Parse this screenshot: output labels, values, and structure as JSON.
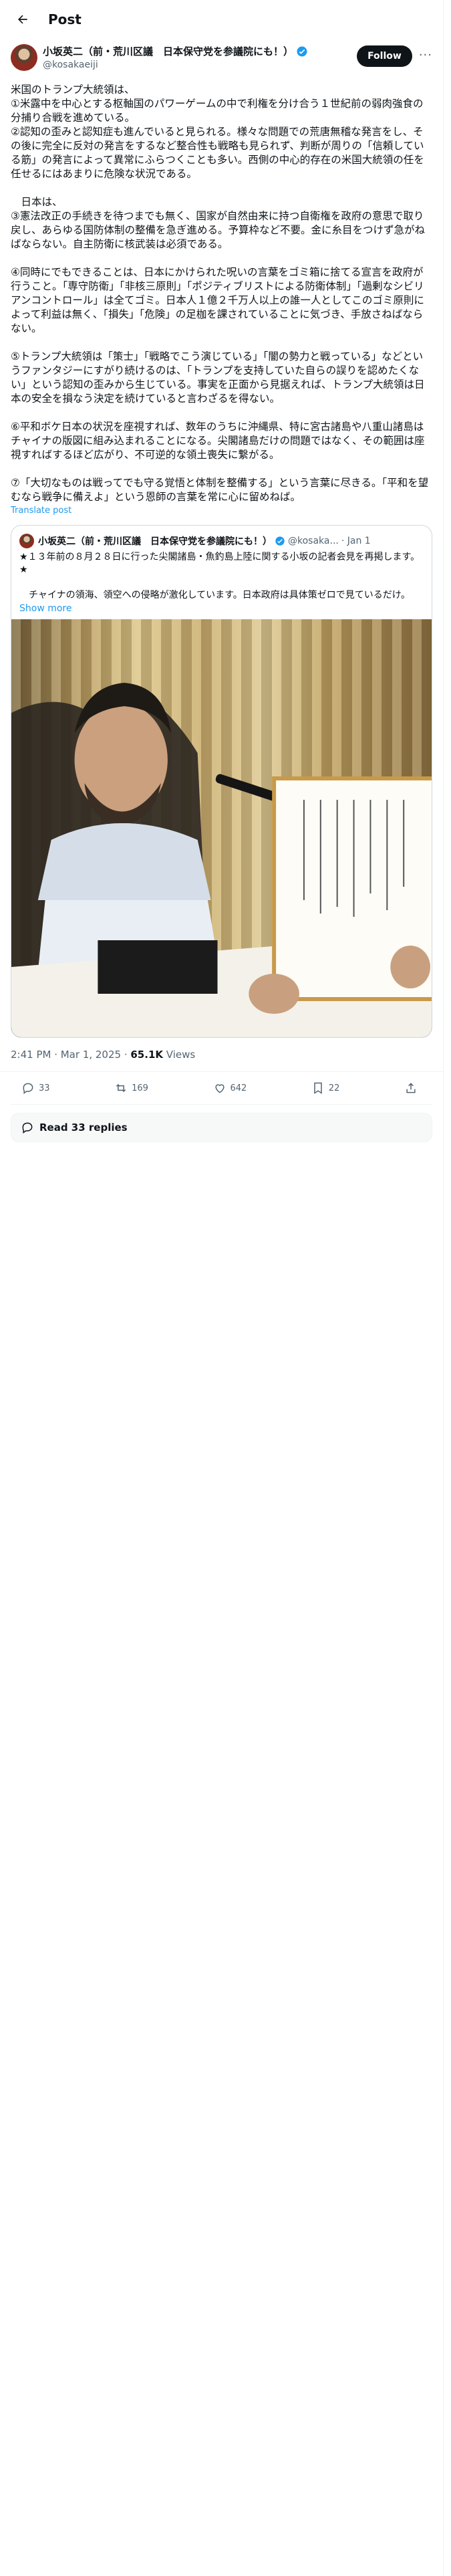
{
  "header": {
    "title": "Post",
    "back_icon": "arrow-left-icon"
  },
  "author": {
    "name": "小坂英二（前・荒川区議　日本保守党を参議院にも！）",
    "handle": "@kosakaeiji",
    "follow_label": "Follow",
    "more_label": "···"
  },
  "tweet": {
    "text": "米国のトランプ大統領は、\n①米露中を中心とする枢軸国のパワーゲームの中で利権を分け合う１世紀前の弱肉強食の分捕り合戦を進めている。\n②認知の歪みと認知症も進んでいると見られる。様々な問題での荒唐無稽な発言をし、その後に完全に反対の発言をするなど整合性も戦略も見られず、判断が周りの「信頼している筋」の発言によって異常にふらつくことも多い。西側の中心的存在の米国大統領の任を任せるにはあまりに危険な状況である。\n\n　日本は、\n③憲法改正の手続きを待つまでも無く、国家が自然由来に持つ自衛権を政府の意思で取り戻し、あらゆる国防体制の整備を急ぎ進める。予算枠など不要。金に糸目をつけず急がねばならない。自主防衛に核武装は必須である。\n\n④同時にでもできることは、日本にかけられた呪いの言葉をゴミ箱に捨てる宣言を政府が行うこと。「専守防衛」「非核三原則」「ポジティブリストによる防衛体制」「過剰なシビリアンコントロール」は全てゴミ。日本人１億２千万人以上の誰一人としてこのゴミ原則によって利益は無く、「損失」「危険」の足枷を課されていることに気づき、手放さねばならない。\n\n⑤トランプ大統領は「策士」「戦略でこう演じている」「闇の勢力と戦っている」などというファンタジーにすがり続けるのは、「トランプを支持していた自らの誤りを認めたくない」という認知の歪みから生じている。事実を正面から見据えれば、トランプ大統領は日本の安全を損なう決定を続けていると言わざるを得ない。\n\n⑥平和ボケ日本の状況を座視すれば、数年のうちに沖縄県、特に宮古諸島や八重山諸島はチャイナの版図に組み込まれることになる。尖閣諸島だけの問題ではなく、その範囲は座視すればするほど広がり、不可逆的な領土喪失に繋がる。\n\n⑦「大切なものは戦ってでも守る覚悟と体制を整備する」という言葉に尽きる。「平和を望むなら戦争に備えよ」という恩師の言葉を常に心に留めねば。",
    "translate_label": "Translate post"
  },
  "quote": {
    "name": "小坂英二（前・荒川区議　日本保守党を参議院にも！）",
    "handle": "@kosaka...",
    "date": "· Jan 1",
    "text": "★１３年前の８月２８日に行った尖閣諸島・魚釣島上陸に関する小坂の記者会見を再掲します。★\n\n　チャイナの領海、領空への侵略が激化しています。日本政府は具体策ゼロで見ているだけ。",
    "show_more_label": "Show more"
  },
  "meta": {
    "time": "2:41 PM · Mar 1, 2025 · ",
    "views_count": "65.1K",
    "views_label": " Views"
  },
  "actions": {
    "replies": "33",
    "reposts": "169",
    "likes": "642",
    "bookmarks": "22"
  },
  "read_replies_label": "Read 33 replies"
}
